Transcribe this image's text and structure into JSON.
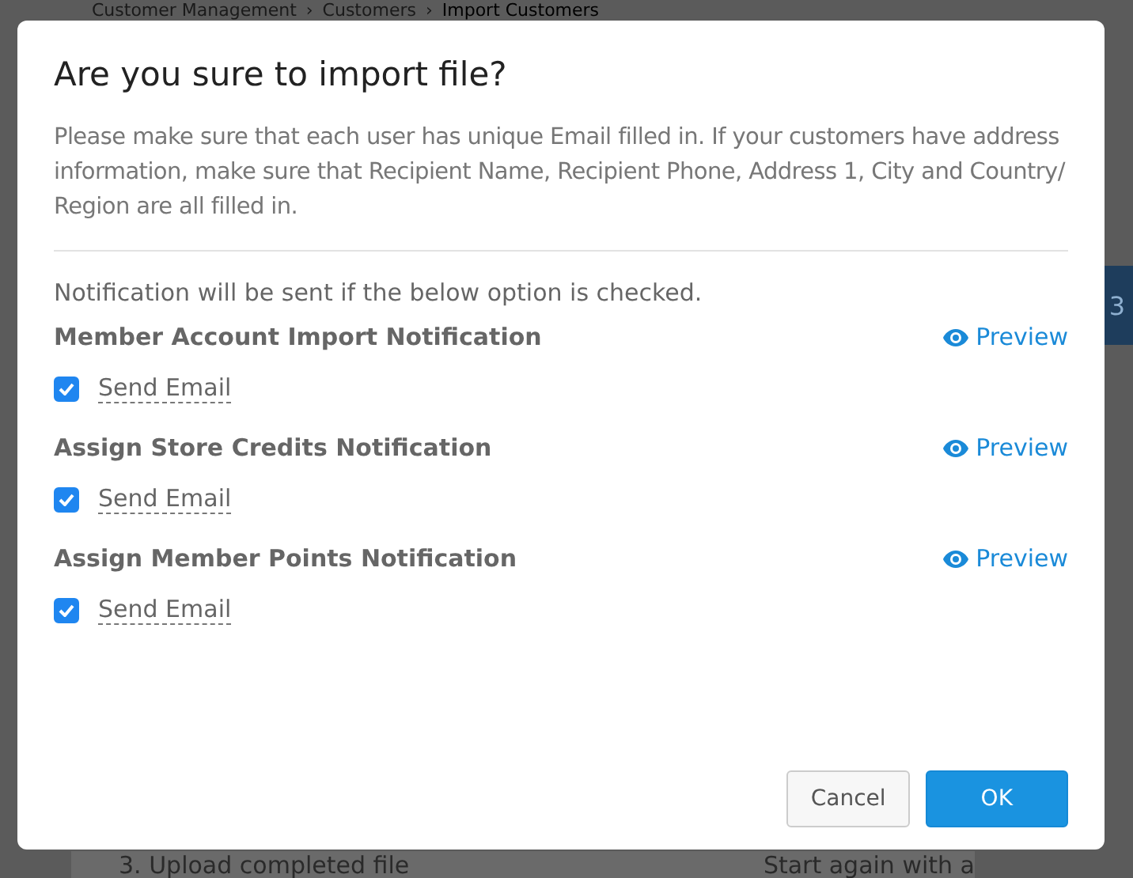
{
  "background": {
    "breadcrumb": [
      "Customer Management",
      "Customers",
      "Import Customers"
    ],
    "separator": "›",
    "step_badge": "3",
    "step_text": "3. Upload completed file",
    "restart_text": "Start again with a"
  },
  "dialog": {
    "title": "Are you sure to import file?",
    "description": "Please make sure that each user has unique Email filled in. If your customers have address information, make sure that Recipient Name, Recipient Phone, Address 1, City and Country/ Region are all filled in.",
    "note": "Notification will be sent if the below option is checked.",
    "notifications": [
      {
        "title": "Member Account Import Notification",
        "preview": "Preview",
        "option": "Send Email",
        "checked": true
      },
      {
        "title": "Assign Store Credits Notification",
        "preview": "Preview",
        "option": "Send Email",
        "checked": true
      },
      {
        "title": "Assign Member Points Notification",
        "preview": "Preview",
        "option": "Send Email",
        "checked": true
      }
    ],
    "buttons": [
      {
        "label": "Cancel",
        "kind": "secondary"
      },
      {
        "label": "OK",
        "kind": "primary"
      }
    ]
  }
}
